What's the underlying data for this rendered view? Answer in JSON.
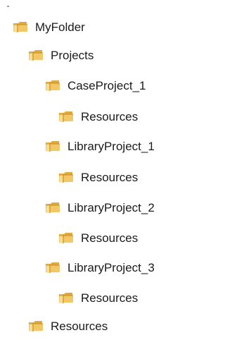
{
  "tree": {
    "nodes": [
      {
        "label": "MyFolder",
        "level": 0,
        "icon": "folder-icon"
      },
      {
        "label": "Projects",
        "level": 1,
        "icon": "folder-icon"
      },
      {
        "label": "CaseProject_1",
        "level": 2,
        "icon": "folder-icon"
      },
      {
        "label": "Resources",
        "level": 3,
        "icon": "folder-icon"
      },
      {
        "label": "LibraryProject_1",
        "level": 2,
        "icon": "folder-icon"
      },
      {
        "label": "Resources",
        "level": 3,
        "icon": "folder-icon"
      },
      {
        "label": "LibraryProject_2",
        "level": 2,
        "icon": "folder-icon"
      },
      {
        "label": "Resources",
        "level": 3,
        "icon": "folder-icon"
      },
      {
        "label": "LibraryProject_3",
        "level": 2,
        "icon": "folder-icon"
      },
      {
        "label": "Resources",
        "level": 3,
        "icon": "folder-icon"
      },
      {
        "label": "Resources",
        "level": 1,
        "icon": "folder-icon"
      }
    ]
  }
}
